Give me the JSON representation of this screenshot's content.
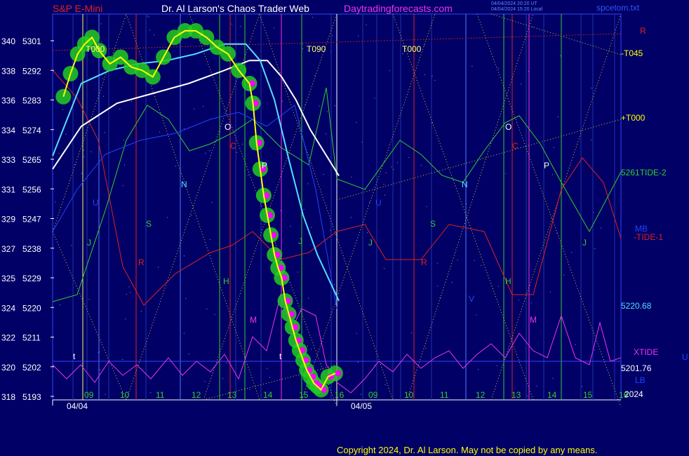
{
  "header": {
    "instrument": "S&P E-Mini",
    "site": "Dr. Al Larson's Chaos Trader Web",
    "url": "Daytradingforecasts.com",
    "update_line_1": "04/04/2024 20:20 UT",
    "update_line_2": "04/04/2024 15:20 Local",
    "file": "spcetom.txt"
  },
  "footer": {
    "copyright": "Copyright 2024, Dr. Al Larson. May not be copied by any means."
  },
  "colors": {
    "background": "#000066",
    "price_line": "#ffff00",
    "price_glow": "#22cc22",
    "mas_white": "#ffffff",
    "mas_cyan": "#55ddff",
    "tide_green": "#33cc33",
    "tide_red": "#dd2222",
    "xtide_magenta": "#ee33ee",
    "planet_blue": "#2244ff",
    "dot_magenta": "#ff00ff"
  },
  "chart_data": {
    "type": "line",
    "title": "S&P E-Mini",
    "y_axis": {
      "labels_left": [
        "340",
        "338",
        "336",
        "334",
        "333",
        "331",
        "329",
        "327",
        "325",
        "324",
        "322",
        "320",
        "318"
      ],
      "labels_right": [
        "5301",
        "5292",
        "5283",
        "5274",
        "5265",
        "5256",
        "5247",
        "5238",
        "5229",
        "5220",
        "5211",
        "5202",
        "5193"
      ],
      "ylim": [
        5193,
        5301
      ]
    },
    "x_axis": {
      "hour_labels": [
        "09",
        "10",
        "11",
        "12",
        "13",
        "14",
        "15",
        "16",
        "09",
        "10",
        "11",
        "12",
        "13",
        "14",
        "15",
        "16"
      ],
      "dates": [
        "04/04",
        "04/05"
      ]
    },
    "price_series": {
      "name": "price",
      "x_hours": [
        8.3,
        8.5,
        8.7,
        8.9,
        9.1,
        9.3,
        9.6,
        9.9,
        10.2,
        10.5,
        10.8,
        11.1,
        11.4,
        11.7,
        12.0,
        12.3,
        12.6,
        12.9,
        13.2,
        13.5,
        13.6,
        13.7,
        13.8,
        13.9,
        14.0,
        14.1,
        14.2,
        14.3,
        14.4,
        14.5,
        14.6,
        14.7,
        14.8,
        14.9,
        15.0,
        15.1,
        15.2,
        15.3,
        15.4,
        15.5,
        15.7,
        15.9
      ],
      "values": [
        5284,
        5291,
        5297,
        5300,
        5302,
        5298,
        5294,
        5296,
        5293,
        5292,
        5290,
        5296,
        5302,
        5304,
        5304,
        5302,
        5299,
        5297,
        5292,
        5288,
        5282,
        5270,
        5262,
        5254,
        5248,
        5242,
        5236,
        5232,
        5229,
        5222,
        5218,
        5214,
        5210,
        5207,
        5204,
        5201,
        5199,
        5197,
        5196,
        5195,
        5199,
        5200
      ]
    },
    "ma_white": {
      "x_hours": [
        8.0,
        8.8,
        9.8,
        10.8,
        11.8,
        12.8,
        13.5,
        14.0,
        14.4,
        14.8,
        15.2,
        16.0
      ],
      "values": [
        5262,
        5275,
        5282,
        5285,
        5288,
        5292,
        5295,
        5295,
        5290,
        5283,
        5274,
        5260
      ]
    },
    "ma_cyan": {
      "x_hours": [
        8.0,
        8.8,
        9.6,
        10.4,
        11.2,
        12.0,
        12.8,
        13.4,
        13.8,
        14.2,
        14.6,
        15.0,
        15.4,
        16.0
      ],
      "values": [
        5266,
        5288,
        5292,
        5294,
        5295,
        5297,
        5300,
        5300,
        5295,
        5283,
        5265,
        5248,
        5236,
        5222
      ]
    },
    "right_labels": {
      "r": "R",
      "t045": "-T045",
      "t000": "+T000",
      "tide2": "5261TIDE-2",
      "tide1": "-TIDE-1",
      "mb": "MB",
      "val_5220": "5220.68",
      "xtide": "XTIDE",
      "val_5201": "5201.76",
      "lb": "LB",
      "year": "2024",
      "u": "U"
    },
    "inner_labels": {
      "t000_left": "T000",
      "t090": "T090",
      "t000_mid": "T000",
      "O": "O",
      "C": "C",
      "P": "P",
      "N": "N",
      "U": "U",
      "S": "S",
      "J": "J",
      "R": "R",
      "H": "H",
      "M": "M",
      "V": "V",
      "t": "t"
    }
  }
}
